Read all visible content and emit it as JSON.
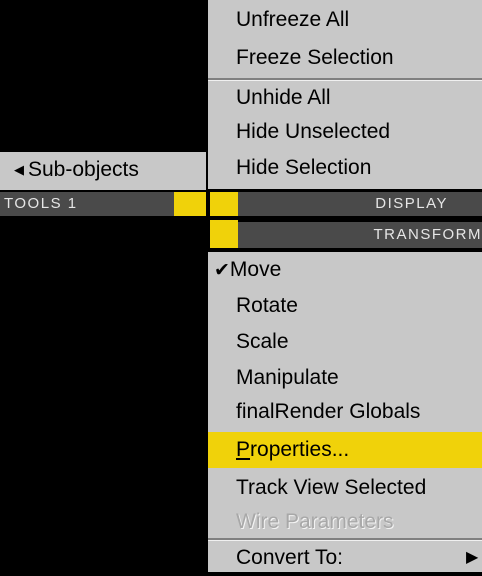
{
  "top_menu": {
    "items": [
      {
        "label": "Unfreeze All"
      },
      {
        "label": "Freeze Selection"
      },
      {
        "label": "Unhide All"
      },
      {
        "label": "Hide Unselected"
      },
      {
        "label": "Hide Selection"
      }
    ]
  },
  "left_menu": {
    "sub_objects": "Sub-objects",
    "left_arrow_glyph": "◀"
  },
  "quad_headers": {
    "tools1": "TOOLS 1",
    "display": "DISPLAY",
    "transform": "TRANSFORM"
  },
  "transform_menu": {
    "check_glyph": "✔",
    "items": [
      {
        "label": "Move",
        "checked": true
      },
      {
        "label": "Rotate"
      },
      {
        "label": "Scale"
      },
      {
        "label": "Manipulate"
      },
      {
        "label": "finalRender Globals"
      },
      {
        "label_first": "P",
        "label_rest": "roperties...",
        "highlighted": true
      },
      {
        "label": "Track View Selected"
      },
      {
        "label": "Wire Parameters",
        "disabled": true
      },
      {
        "label": "Convert To:",
        "submenu": true
      }
    ],
    "submenu_arrow_glyph": "▶"
  },
  "colors": {
    "menu_bg": "#c8c8c8",
    "header_bg": "#4a4a4a",
    "highlight": "#f0d20a",
    "background": "#000000"
  }
}
